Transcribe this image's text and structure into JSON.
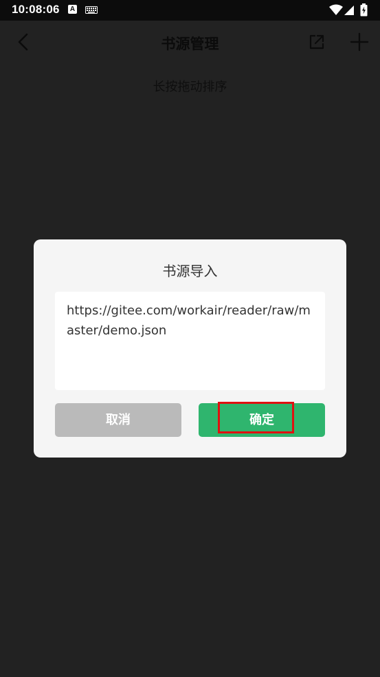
{
  "status_bar": {
    "time": "10:08:06",
    "notification_letter": "A"
  },
  "app_bar": {
    "title": "书源管理"
  },
  "hint": "长按拖动排序",
  "dialog": {
    "title": "书源导入",
    "url_value": "https://gitee.com/workair/reader/raw/master/demo.json",
    "cancel_label": "取消",
    "confirm_label": "确定"
  },
  "colors": {
    "background": "#222222",
    "dialog_background": "#f5f5f5",
    "confirm": "#2fb56e",
    "cancel": "#bababa",
    "highlight": "#e01010"
  }
}
